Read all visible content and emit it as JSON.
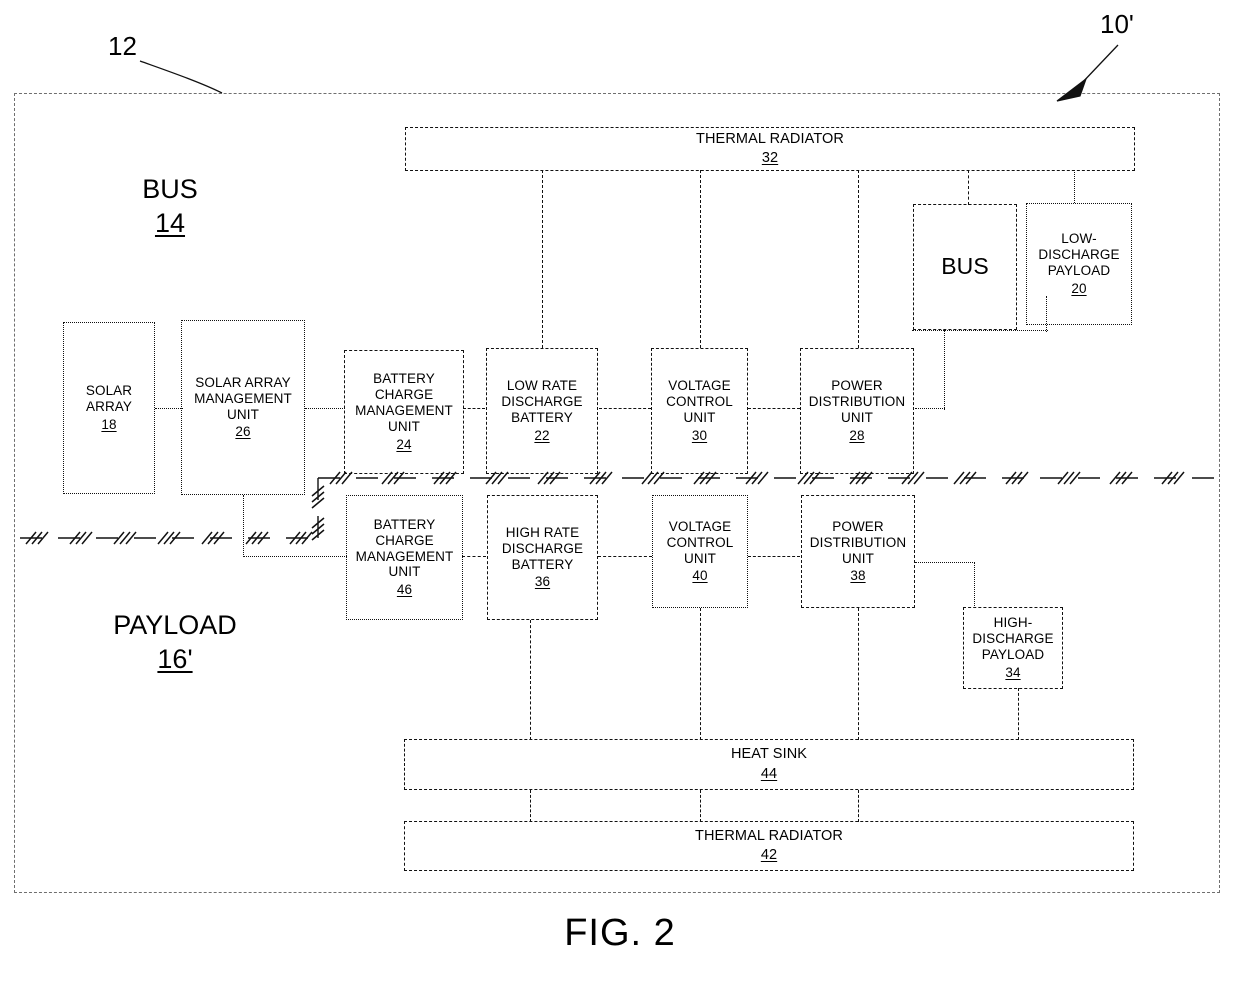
{
  "figure": {
    "caption": "FIG. 2",
    "system_ref": "10'",
    "outer_boundary_ref": "12"
  },
  "sections": {
    "bus": {
      "label": "BUS",
      "ref": "14"
    },
    "payload": {
      "label": "PAYLOAD",
      "ref": "16'"
    }
  },
  "blocks": {
    "thermal_radiator_top": {
      "label": "THERMAL RADIATOR",
      "ref": "32"
    },
    "bus_node": {
      "label": "BUS",
      "ref": ""
    },
    "low_discharge_payload": {
      "label": "LOW-\nDISCHARGE\nPAYLOAD",
      "ref": "20"
    },
    "solar_array": {
      "label": "SOLAR\nARRAY",
      "ref": "18"
    },
    "solar_array_mgmt": {
      "label": "SOLAR ARRAY\nMANAGEMENT\nUNIT",
      "ref": "26"
    },
    "battery_charge_mgmt_bus": {
      "label": "BATTERY\nCHARGE\nMANAGEMENT\nUNIT",
      "ref": "24"
    },
    "low_rate_battery": {
      "label": "LOW RATE\nDISCHARGE\nBATTERY",
      "ref": "22"
    },
    "voltage_control_bus": {
      "label": "VOLTAGE\nCONTROL\nUNIT",
      "ref": "30"
    },
    "power_distribution_bus": {
      "label": "POWER\nDISTRIBUTION\nUNIT",
      "ref": "28"
    },
    "battery_charge_mgmt_payload": {
      "label": "BATTERY\nCHARGE\nMANAGEMENT\nUNIT",
      "ref": "46"
    },
    "high_rate_battery": {
      "label": "HIGH RATE\nDISCHARGE\nBATTERY",
      "ref": "36"
    },
    "voltage_control_payload": {
      "label": "VOLTAGE\nCONTROL\nUNIT",
      "ref": "40"
    },
    "power_distribution_payload": {
      "label": "POWER\nDISTRIBUTION\nUNIT",
      "ref": "38"
    },
    "high_discharge_payload": {
      "label": "HIGH-\nDISCHARGE\nPAYLOAD",
      "ref": "34"
    },
    "heat_sink": {
      "label": "HEAT SINK",
      "ref": "44"
    },
    "thermal_radiator_bottom": {
      "label": "THERMAL RADIATOR",
      "ref": "42"
    }
  },
  "colors": {
    "stroke": "#111111",
    "outer_stroke": "#6f6f6f",
    "background": "#ffffff"
  }
}
